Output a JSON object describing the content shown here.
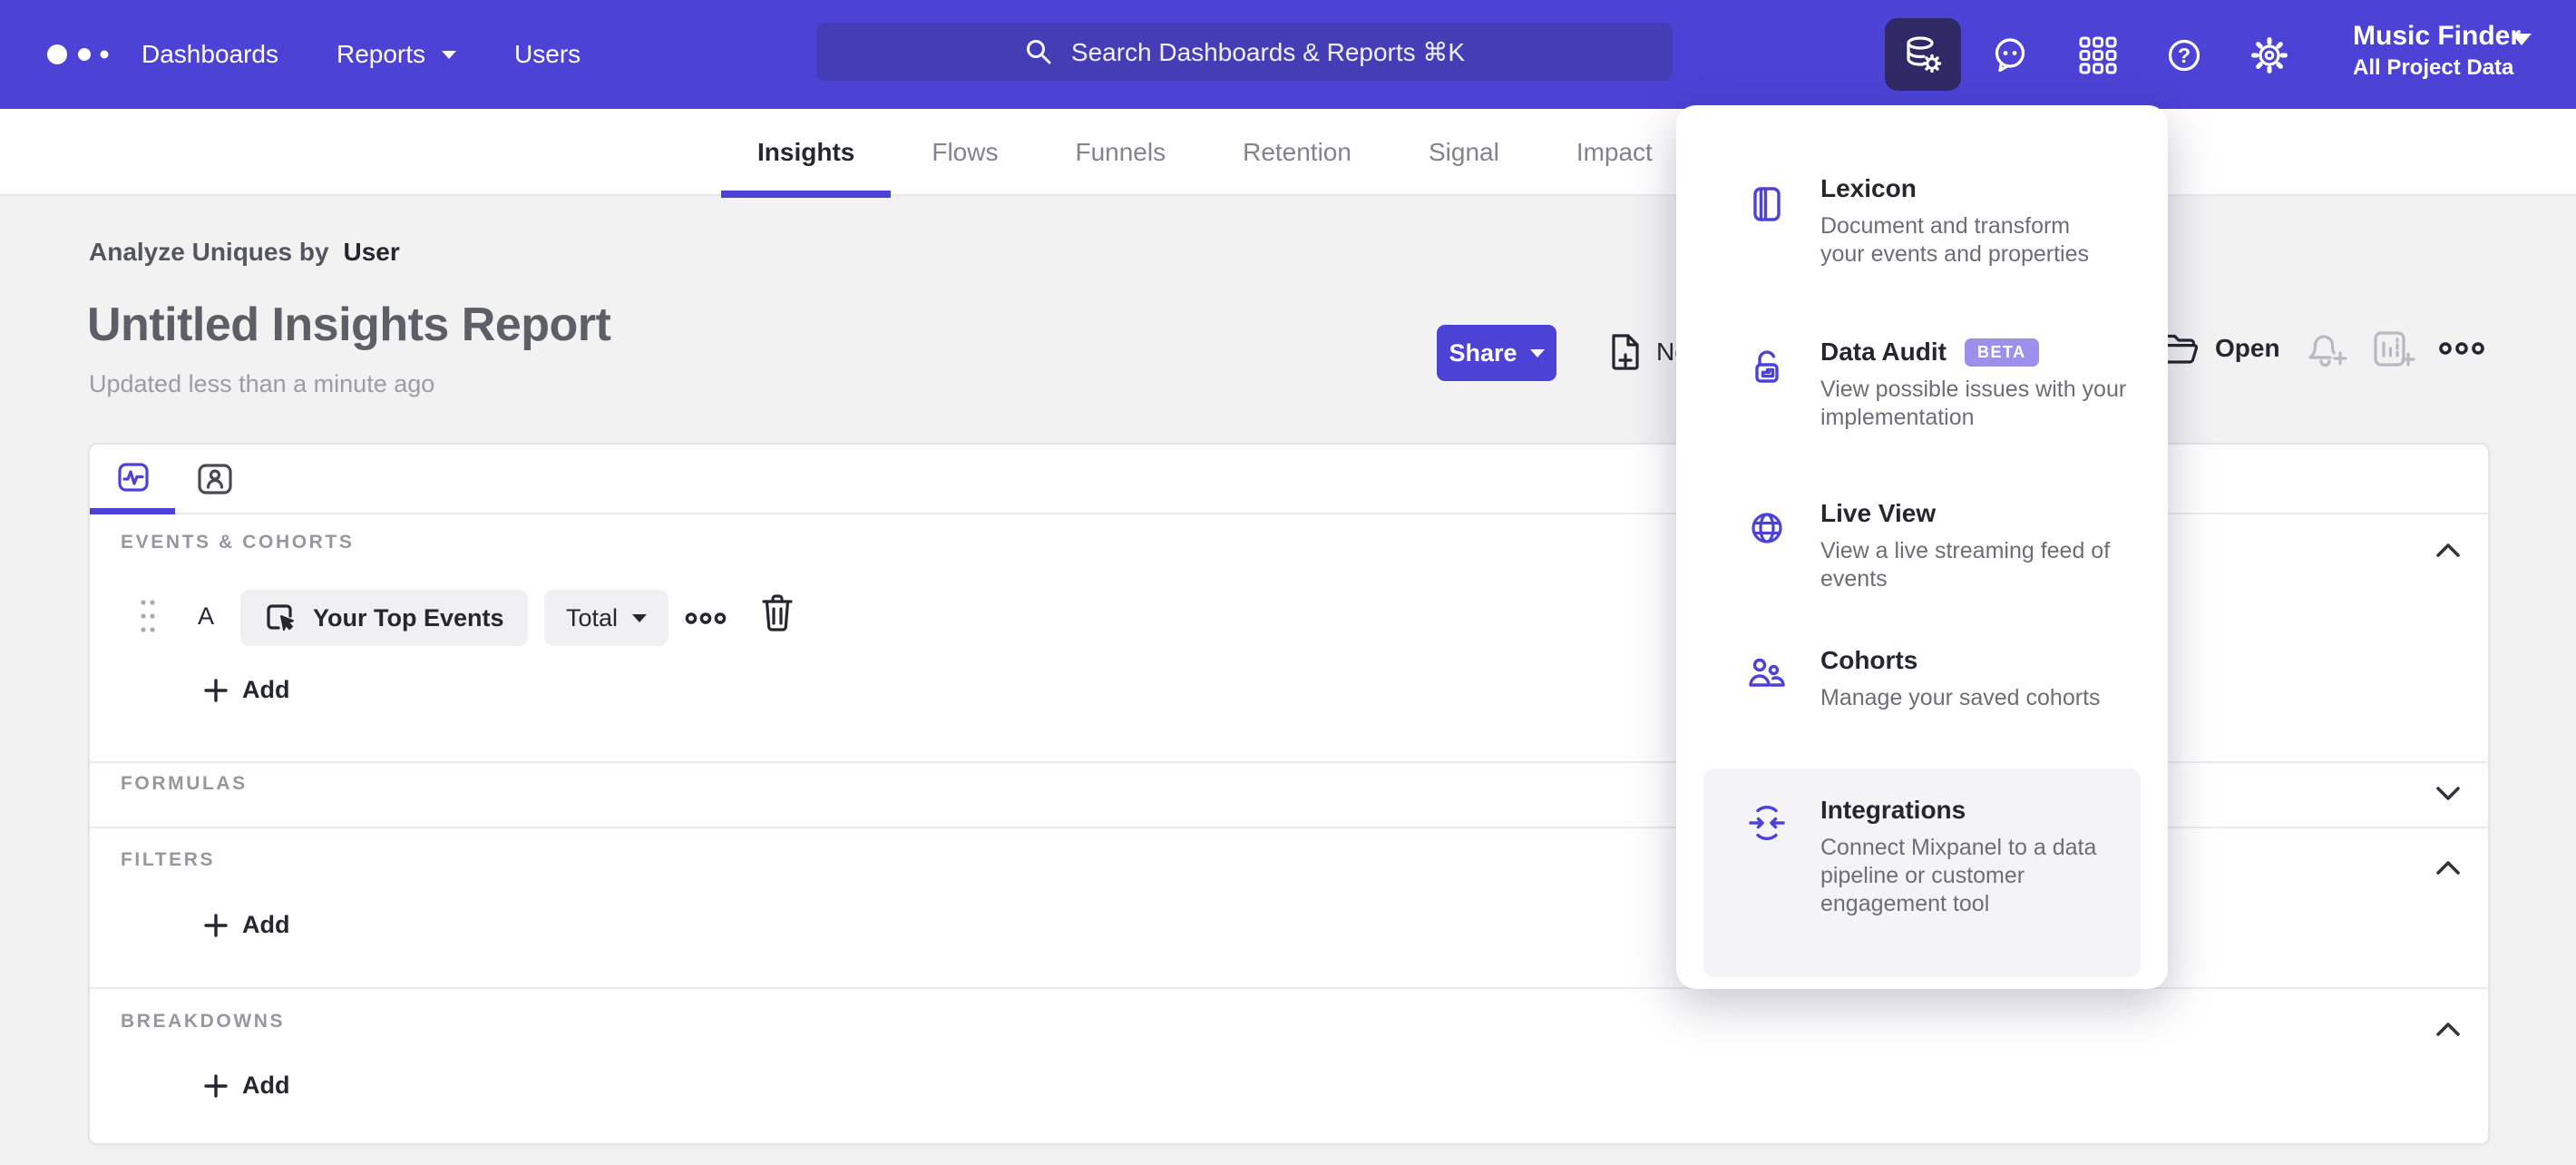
{
  "colors": {
    "accent_purple": "#4c43d6",
    "navbar_bg": "#4c43d6",
    "active_tool_bg": "#2f2a66",
    "beta_badge_bg": "#9d90ec",
    "page_bg": "#f2f2f3"
  },
  "navbar": {
    "menu": [
      {
        "label": "Dashboards"
      },
      {
        "label": "Reports",
        "has_caret": true
      },
      {
        "label": "Users"
      }
    ],
    "search_placeholder": "Search Dashboards & Reports ⌘K",
    "icons": [
      "data-management-icon",
      "feedback-chat-icon",
      "apps-grid-icon",
      "help-icon",
      "settings-gear-icon"
    ],
    "project": {
      "name": "Music Finder",
      "scope": "All Project Data"
    }
  },
  "tabs": {
    "items": [
      {
        "label": "Insights",
        "active": true
      },
      {
        "label": "Flows"
      },
      {
        "label": "Funnels"
      },
      {
        "label": "Retention"
      },
      {
        "label": "Signal"
      },
      {
        "label": "Impact"
      }
    ]
  },
  "report": {
    "analyze_prefix": "Analyze Uniques by",
    "analyze_value": "User",
    "title": "Untitled Insights Report",
    "updated": "Updated less than a minute ago",
    "actions": {
      "share": "Share",
      "new": "New",
      "open": "Open"
    }
  },
  "builder": {
    "labels": {
      "events": "EVENTS & COHORTS",
      "formulas": "FORMULAS",
      "filters": "FILTERS",
      "breakdowns": "BREAKDOWNS"
    },
    "query_row": {
      "letter": "A",
      "event": "Your Top Events",
      "aggregation": "Total"
    },
    "add_label": "Add"
  },
  "menu_panel": {
    "items": [
      {
        "title": "Lexicon",
        "icon": "lexicon-book-icon",
        "lines": [
          "Document and transform",
          "your events and properties"
        ]
      },
      {
        "title": "Data Audit",
        "badge": "BETA",
        "icon": "data-audit-lock-icon",
        "lines": [
          "View possible issues with your",
          "implementation"
        ]
      },
      {
        "title": "Live View",
        "icon": "live-view-globe-icon",
        "lines": [
          "View a live streaming feed of",
          "events"
        ]
      },
      {
        "title": "Cohorts",
        "icon": "cohorts-people-icon",
        "lines": [
          "Manage your saved cohorts"
        ]
      },
      {
        "title": "Integrations",
        "icon": "integrations-sync-icon",
        "highlighted": true,
        "lines": [
          "Connect Mixpanel to a data",
          "pipeline or customer",
          "engagement tool"
        ]
      }
    ]
  }
}
